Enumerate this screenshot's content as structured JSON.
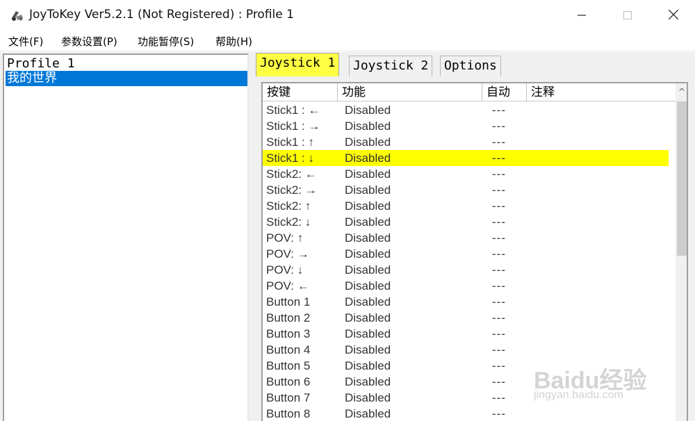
{
  "window": {
    "title": "JoyToKey Ver5.2.1 (Not Registered) : Profile 1",
    "minimize_glyph": "—",
    "maximize_glyph": "☐",
    "close_glyph": "✕"
  },
  "menu": {
    "items": [
      {
        "label": "文件(F)"
      },
      {
        "label": "参数设置(P)"
      },
      {
        "label": "功能暂停(S)"
      },
      {
        "label": "帮助(H)"
      }
    ]
  },
  "profiles": {
    "items": [
      {
        "label": "Profile 1"
      },
      {
        "label": "我的世界"
      }
    ],
    "selected_index": 1
  },
  "tabs": {
    "items": [
      {
        "label": "Joystick 1"
      },
      {
        "label": "Joystick 2"
      },
      {
        "label": "Options"
      }
    ],
    "active_index": 0
  },
  "table": {
    "headers": [
      "按键",
      "功能",
      "自动",
      "注释"
    ],
    "scroll_up_glyph": "^",
    "rows": [
      {
        "key": "Stick1 : ←",
        "function": "Disabled",
        "auto": "---"
      },
      {
        "key": "Stick1 : →",
        "function": "Disabled",
        "auto": "---"
      },
      {
        "key": "Stick1 : ↑",
        "function": "Disabled",
        "auto": "---"
      },
      {
        "key": "Stick1 : ↓",
        "function": "Disabled",
        "auto": "---"
      },
      {
        "key": "Stick2: ←",
        "function": "Disabled",
        "auto": "---"
      },
      {
        "key": "Stick2: →",
        "function": "Disabled",
        "auto": "---"
      },
      {
        "key": "Stick2: ↑",
        "function": "Disabled",
        "auto": "---"
      },
      {
        "key": "Stick2: ↓",
        "function": "Disabled",
        "auto": "---"
      },
      {
        "key": "POV: ↑",
        "function": "Disabled",
        "auto": "---"
      },
      {
        "key": "POV: →",
        "function": "Disabled",
        "auto": "---"
      },
      {
        "key": "POV: ↓",
        "function": "Disabled",
        "auto": "---"
      },
      {
        "key": "POV: ←",
        "function": "Disabled",
        "auto": "---"
      },
      {
        "key": "Button 1",
        "function": "Disabled",
        "auto": "---"
      },
      {
        "key": "Button 2",
        "function": "Disabled",
        "auto": "---"
      },
      {
        "key": "Button 3",
        "function": "Disabled",
        "auto": "---"
      },
      {
        "key": "Button 4",
        "function": "Disabled",
        "auto": "---"
      },
      {
        "key": "Button 5",
        "function": "Disabled",
        "auto": "---"
      },
      {
        "key": "Button 6",
        "function": "Disabled",
        "auto": "---"
      },
      {
        "key": "Button 7",
        "function": "Disabled",
        "auto": "---"
      },
      {
        "key": "Button 8",
        "function": "Disabled",
        "auto": "---"
      }
    ],
    "highlight_index": 3,
    "highlight_color": "#ffff00"
  },
  "watermark": {
    "logo": "Baidu经验",
    "url": "jingyan.baidu.com"
  },
  "colors": {
    "selection_blue": "#0078d7",
    "active_tab_yellow": "#ffff44"
  }
}
